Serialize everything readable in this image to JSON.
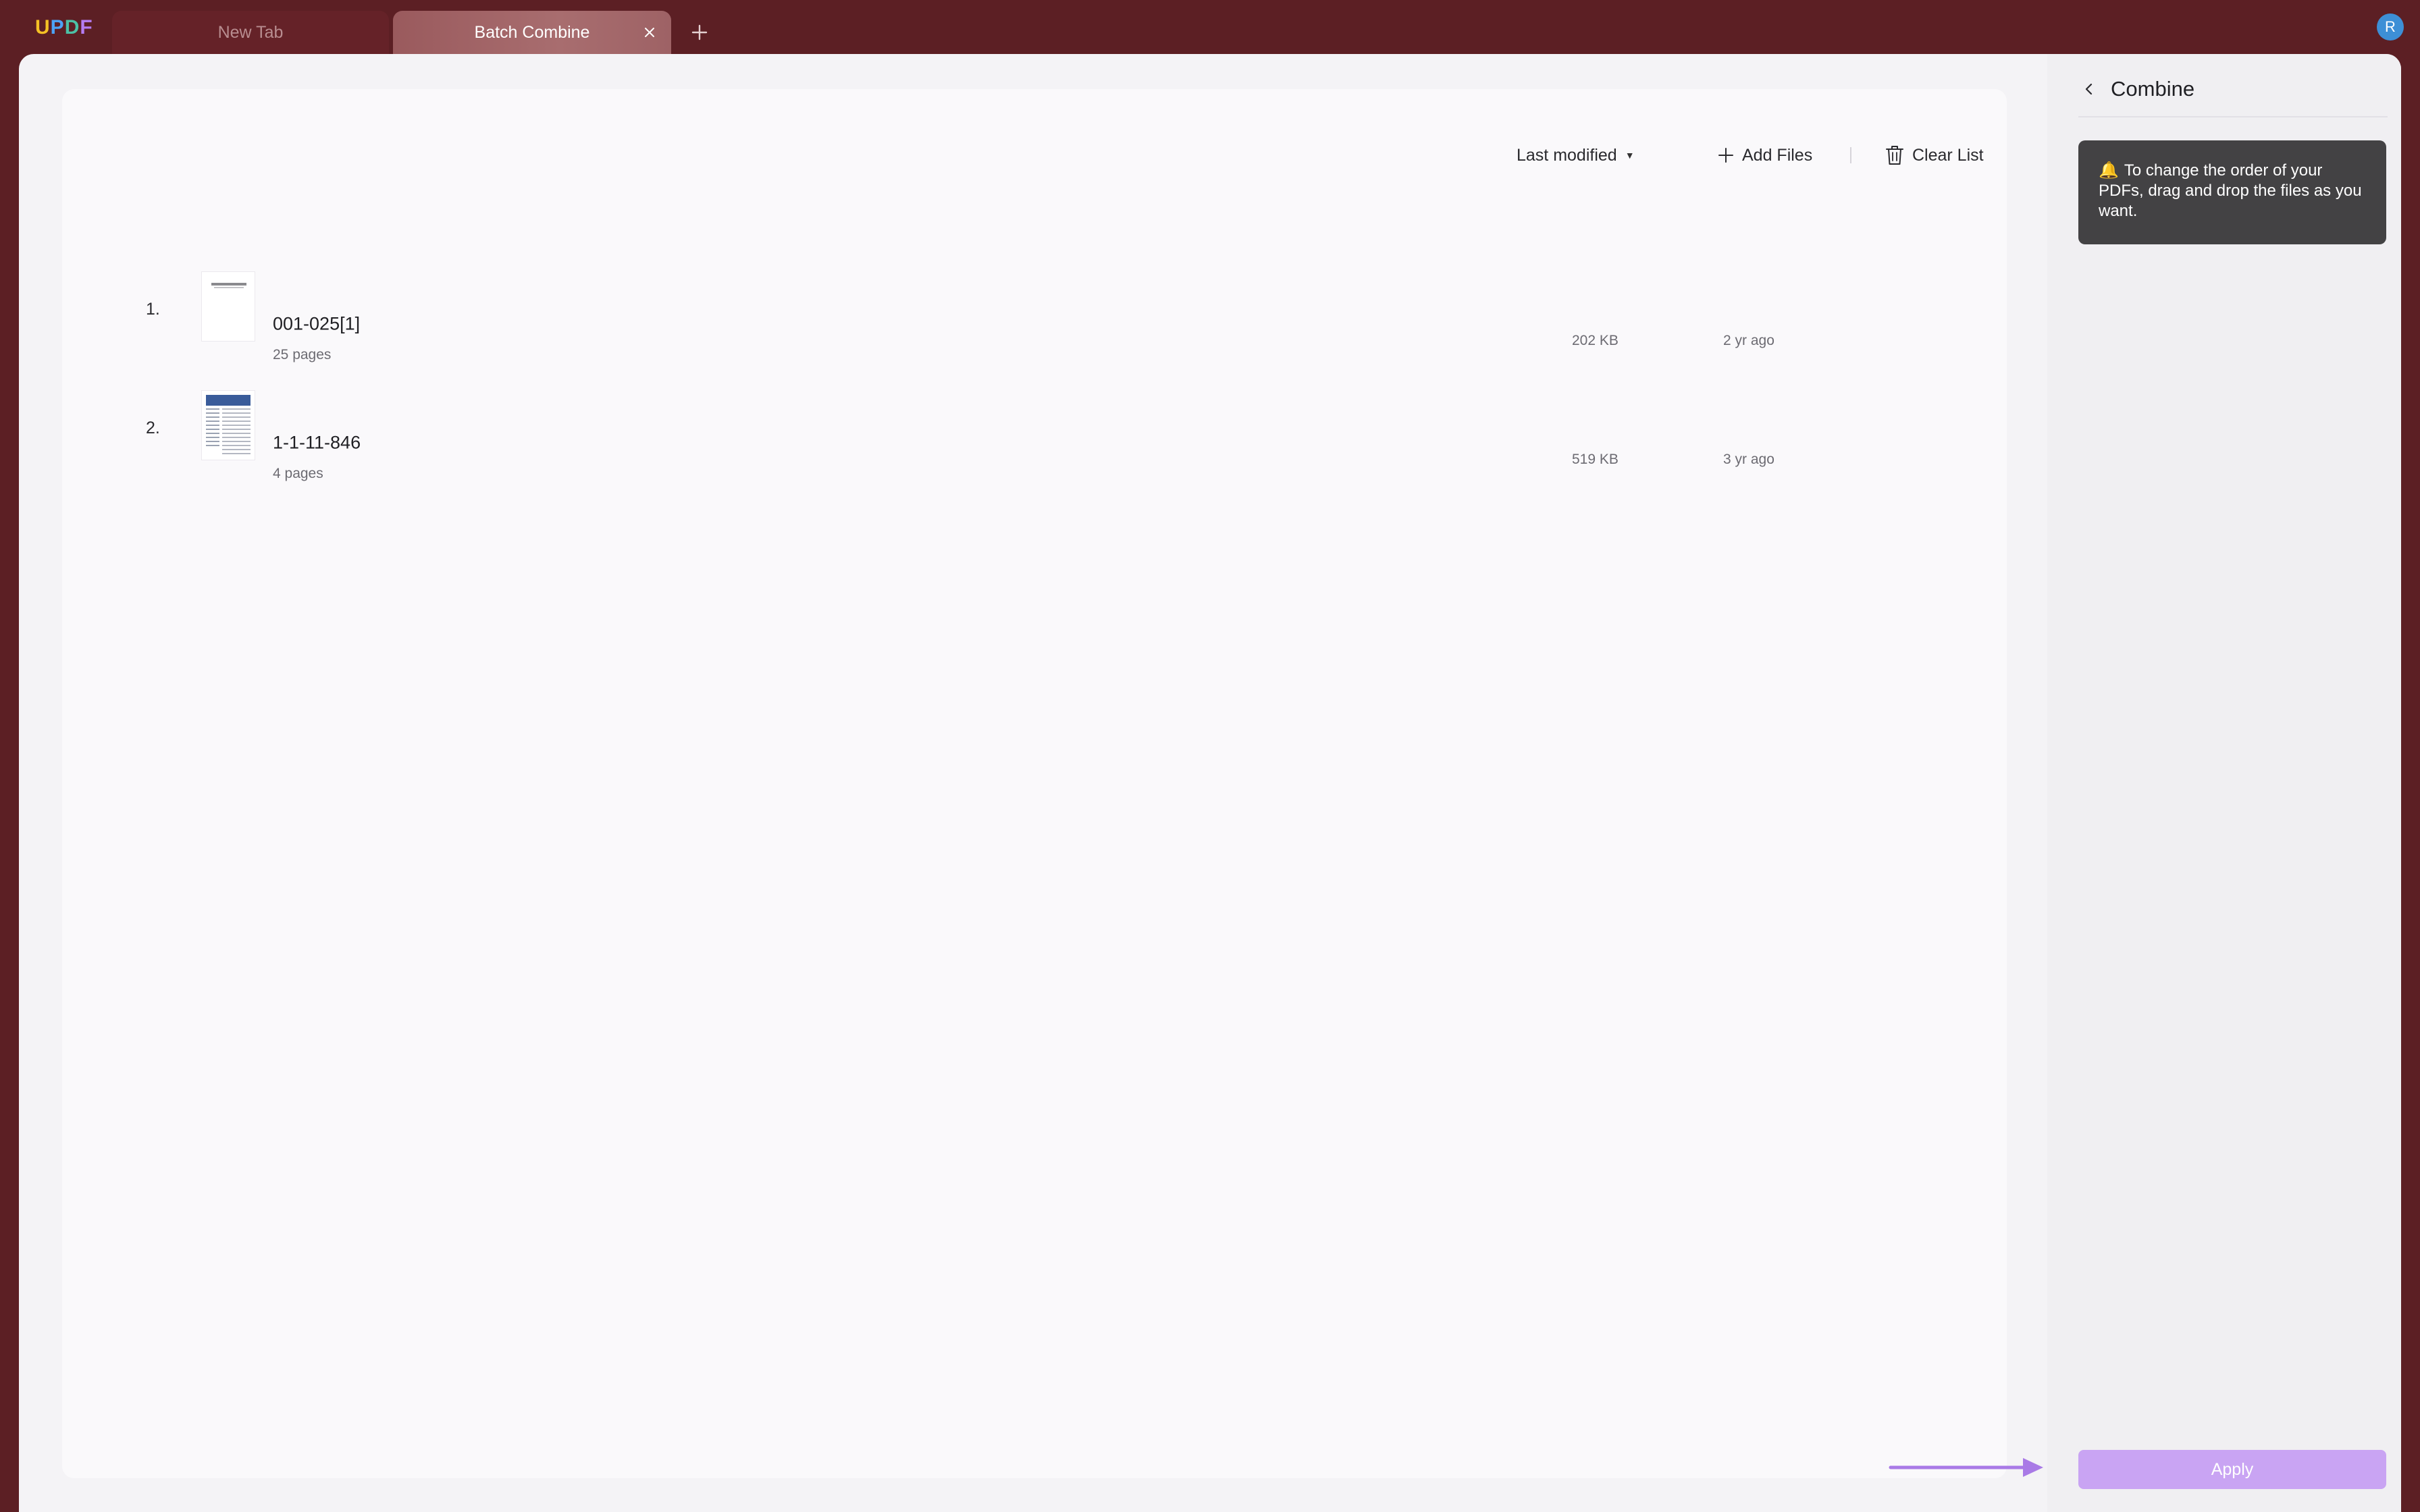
{
  "app": {
    "logo_text": "UPDF",
    "logo_colors": [
      "#f5c125",
      "#4da3f5",
      "#4cc1a6",
      "#b57cf2"
    ]
  },
  "tabs": [
    {
      "label": "New Tab",
      "active": false
    },
    {
      "label": "Batch Combine",
      "active": true
    }
  ],
  "user": {
    "avatar_initial": "R",
    "avatar_color": "#3d8fd6"
  },
  "toolbar": {
    "sort_label": "Last modified",
    "add_files_label": "Add Files",
    "clear_list_label": "Clear List"
  },
  "files": [
    {
      "index": "1.",
      "name": "001-025[1]",
      "pages": "25 pages",
      "size": "202 KB",
      "modified": "2 yr ago"
    },
    {
      "index": "2.",
      "name": "1-1-11-846",
      "pages": "4 pages",
      "size": "519 KB",
      "modified": "3 yr ago"
    }
  ],
  "panel": {
    "title": "Combine",
    "tip_icon": "🔔",
    "tip_text": "To change the order of your PDFs, drag and drop the files as you want.",
    "apply_label": "Apply"
  },
  "colors": {
    "chrome_bg": "#5c1f24",
    "apply_bg": "#c9a4f3",
    "tip_bg": "#434244"
  }
}
